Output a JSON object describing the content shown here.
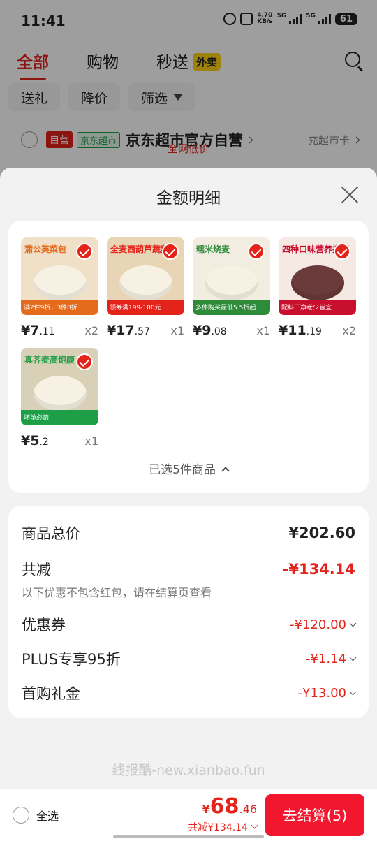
{
  "status_bar": {
    "time": "11:41",
    "net_speed_value": "4.70",
    "net_speed_unit": "KB/s",
    "sig1_label": "5G",
    "sig2_label": "5G",
    "battery": "61"
  },
  "cart": {
    "tabs": [
      "全部",
      "购物",
      "秒送"
    ],
    "waimai_badge": "外卖",
    "chips": [
      "送礼",
      "降价",
      "筛选"
    ],
    "store": {
      "tag_ziying": "自营",
      "tag_jd": "京东超市",
      "name": "京东超市官方自营",
      "card_link": "充超市卡",
      "sub": "全网低价"
    }
  },
  "sheet": {
    "title": "金额明细",
    "items": [
      {
        "label": "蒲公英菜包",
        "band": "满2件9折，3件8折",
        "price_int": "¥7",
        "price_dec": ".11",
        "qty": "x2",
        "bg": "#f0e0c8",
        "accent": "#e46a1c"
      },
      {
        "label": "全麦西葫芦蔬菜卷",
        "band": "领券满199-100元",
        "price_int": "¥17",
        "price_dec": ".57",
        "qty": "x1",
        "bg": "#e8d5b5",
        "accent": "#e4231a"
      },
      {
        "label": "糯米烧麦",
        "band": "多件购买最低5.5折起",
        "price_int": "¥9",
        "price_dec": ".08",
        "qty": "x1",
        "bg": "#f2ede0",
        "accent": "#2e8b3a"
      },
      {
        "label": "四种口味营养搭配",
        "band": "配料干净老少皆宜",
        "price_int": "¥11",
        "price_dec": ".19",
        "qty": "x2",
        "bg": "#f5e9e4",
        "accent": "#c8102e"
      },
      {
        "label": "真荠麦高饱腹",
        "band": "坏单必赔",
        "price_int": "¥5",
        "price_dec": ".2",
        "qty": "x1",
        "bg": "#d9d0b8",
        "accent": "#1f9e48"
      }
    ],
    "selected_count": "已选5件商品"
  },
  "price_detail": {
    "total_label": "商品总价",
    "total_value": "¥202.60",
    "reduce_label": "共减",
    "reduce_value": "-¥134.14",
    "note": "以下优惠不包含红包，请在结算页查看",
    "rows": [
      {
        "label": "优惠券",
        "value": "-¥120.00"
      },
      {
        "label": "PLUS专享95折",
        "value": "-¥1.14"
      },
      {
        "label": "首购礼金",
        "value": "-¥13.00"
      }
    ]
  },
  "watermark": "线报酷-new.xianbao.fun",
  "bottom_bar": {
    "select_all": "全选",
    "currency": "¥",
    "total_int": "68",
    "total_dec": ".46",
    "reduce_text": "共减¥134.14",
    "checkout": "去结算(5)"
  },
  "colors": {
    "accent_red": "#e4231a",
    "checkout_red": "#f2162f",
    "jd_green": "#1f9e48",
    "badge_yellow": "#ffd21a"
  }
}
